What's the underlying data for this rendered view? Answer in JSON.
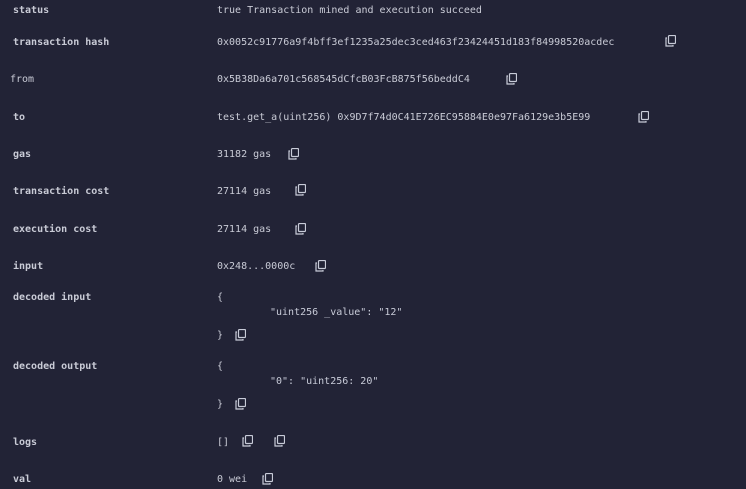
{
  "rows": {
    "status": {
      "label": "status",
      "value": "true Transaction mined and execution succeed"
    },
    "hash": {
      "label": "transaction hash",
      "value": "0x0052c91776a9f4bff3ef1235a25dec3ced463f23424451d183f84998520acdec"
    },
    "from": {
      "label": "from",
      "value": "0x5B38Da6a701c568545dCfcB03FcB875f56beddC4"
    },
    "to": {
      "label": "to",
      "value": "test.get_a(uint256) 0x9D7f74d0C41E726EC95884E0e97Fa6129e3b5E99"
    },
    "gas": {
      "label": "gas",
      "value": "31182 gas"
    },
    "tx_cost": {
      "label": "transaction cost",
      "value": "27114 gas"
    },
    "exec_cost": {
      "label": "execution cost",
      "value": "27114 gas"
    },
    "input": {
      "label": "input",
      "value": "0x248...0000c"
    },
    "decoded_input": {
      "label": "decoded input",
      "open": "{",
      "line": "\"uint256 _value\": \"12\"",
      "close": "}"
    },
    "decoded_output": {
      "label": "decoded output",
      "open": "{",
      "line": "\"0\": \"uint256: 20\"",
      "close": "}"
    },
    "logs": {
      "label": "logs",
      "value": "[]"
    },
    "val": {
      "label": "val",
      "value": "0 wei"
    }
  },
  "icons": {
    "copy": "copy-icon"
  }
}
